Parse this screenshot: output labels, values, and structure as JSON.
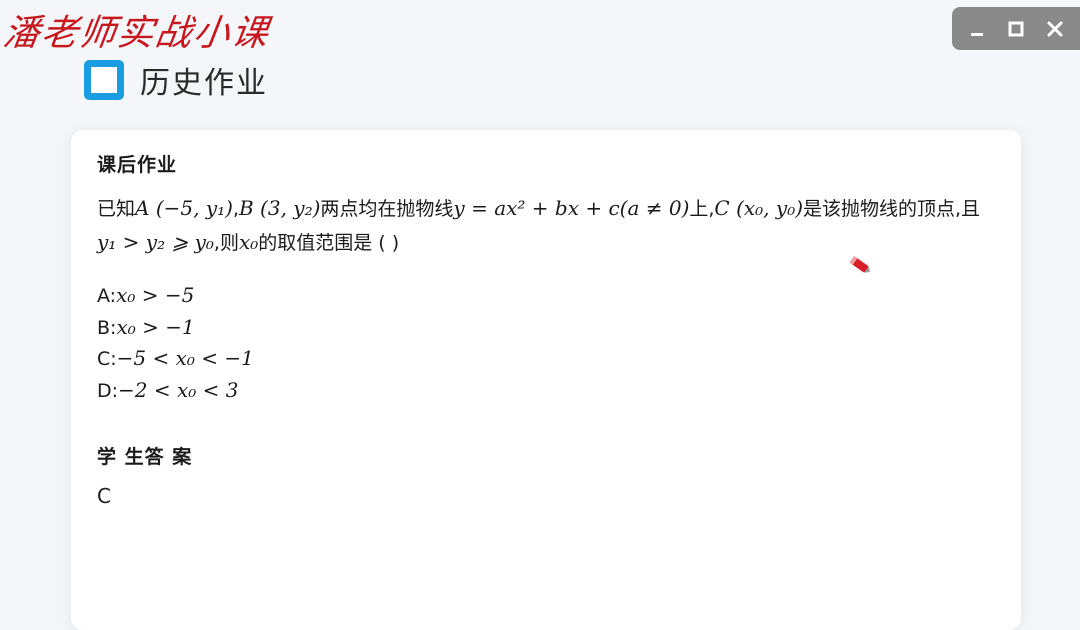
{
  "watermark": "潘老师实战小课",
  "window_controls": {
    "minimize_icon": "minimize-icon",
    "maximize_icon": "maximize-icon",
    "close_icon": "close-icon",
    "background": "#8a8a8a"
  },
  "header": {
    "title": "历史作业",
    "icon": "square-outline-icon",
    "icon_color": "#1a9de0"
  },
  "homework": {
    "section_title": "课后作业",
    "question": {
      "t1": "已知",
      "m1": "A (−5, y₁)",
      "t2": ",",
      "m2": "B (3, y₂)",
      "t3": "两点均在抛物线",
      "m3": "y = ax² + bx + c(a ≠ 0)",
      "t4": "上,",
      "m4": "C (x₀, y₀)",
      "t5": "是该抛物线的顶点,且",
      "m5": "y₁ > y₂ ⩾ y₀",
      "t6": ",则",
      "m6": "x₀",
      "t7": "的取值范围是 (      )"
    },
    "options": [
      {
        "label": "A:",
        "expr": "x₀ > −5"
      },
      {
        "label": "B:",
        "expr": "x₀ > −1"
      },
      {
        "label": "C:",
        "expr": "−5 < x₀ < −1"
      },
      {
        "label": "D:",
        "expr": "−2 < x₀ < 3"
      }
    ]
  },
  "student_answer": {
    "section_title": "学 生答 案",
    "value": "C"
  },
  "cursor": {
    "icon": "pen-cursor-icon",
    "color": "#d8202a"
  }
}
